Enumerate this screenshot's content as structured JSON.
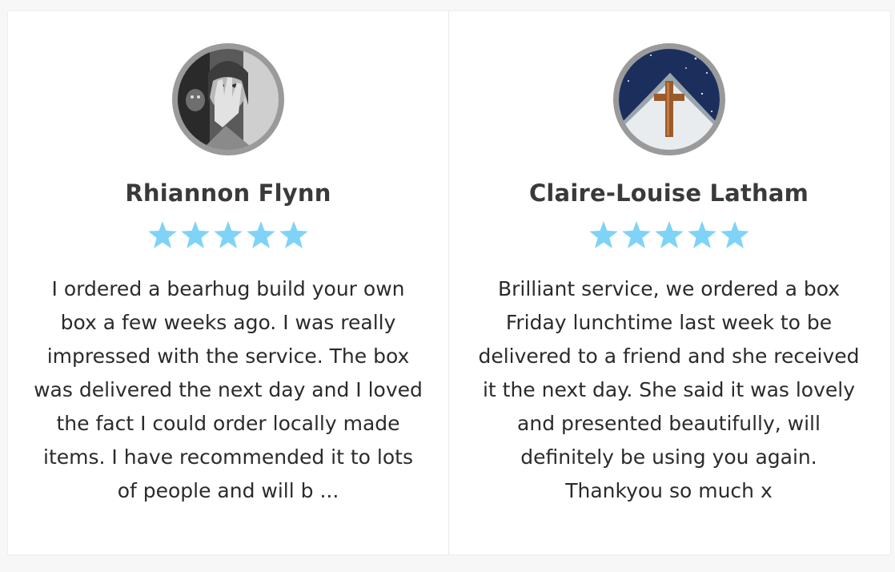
{
  "reviews": [
    {
      "name": "Rhiannon Flynn",
      "rating": 5,
      "text": "I ordered a bearhug build your own box a few weeks ago. I was really impressed with the service. The box was delivered the next day and I loved the fact I could order locally made items. I have recommended it to lots of people and will b ...",
      "avatar_icon": "woman-portrait-avatar"
    },
    {
      "name": "Claire-Louise Latham",
      "rating": 5,
      "text": "Brilliant service, we ordered a box Friday lunchtime last week to be delivered to a friend and she received it the next day. She said it was lovely and presented beautifully, will definitely be using you again. Thankyou so much x",
      "avatar_icon": "church-cross-avatar"
    }
  ],
  "colors": {
    "star": "#7fd3f7",
    "name": "#3a3a3a",
    "text": "#2b2b2b",
    "avatar_border": "#9a9a9a"
  }
}
